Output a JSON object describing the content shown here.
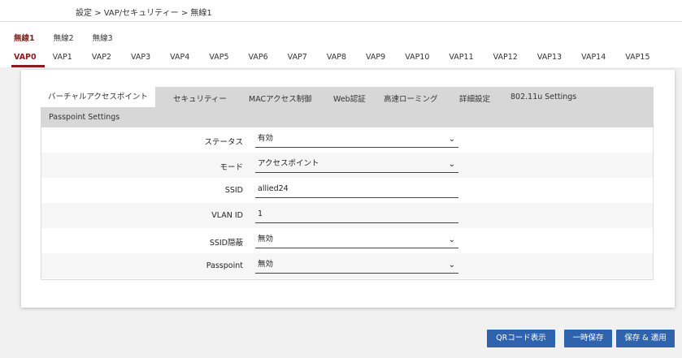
{
  "breadcrumb": "設定 > VAP/セキュリティー > 無線1",
  "wireless_tabs": [
    "無線1",
    "無線2",
    "無線3"
  ],
  "vap_tabs": [
    "VAP0",
    "VAP1",
    "VAP2",
    "VAP3",
    "VAP4",
    "VAP5",
    "VAP6",
    "VAP7",
    "VAP8",
    "VAP9",
    "VAP10",
    "VAP11",
    "VAP12",
    "VAP13",
    "VAP14",
    "VAP15"
  ],
  "sub_tabs": [
    "バーチャルアクセスポイント",
    "セキュリティー",
    "MACアクセス制御",
    "Web認証",
    "高速ローミング",
    "詳細設定",
    "802.11u Settings",
    "Passpoint Settings"
  ],
  "form": {
    "status": {
      "label": "ステータス",
      "value": "有効"
    },
    "mode": {
      "label": "モード",
      "value": "アクセスポイント"
    },
    "ssid": {
      "label": "SSID",
      "value": "allied24"
    },
    "vlan": {
      "label": "VLAN ID",
      "value": "1"
    },
    "ssid_hidden": {
      "label": "SSID隠蔽",
      "value": "無効"
    },
    "passpoint": {
      "label": "Passpoint",
      "value": "無効"
    }
  },
  "buttons": {
    "qr": "QRコード表示",
    "temp_save": "一時保存",
    "save_apply": "保存 & 適用"
  },
  "colors": {
    "accent": "#8b1a1a",
    "button": "#2f63ad"
  }
}
